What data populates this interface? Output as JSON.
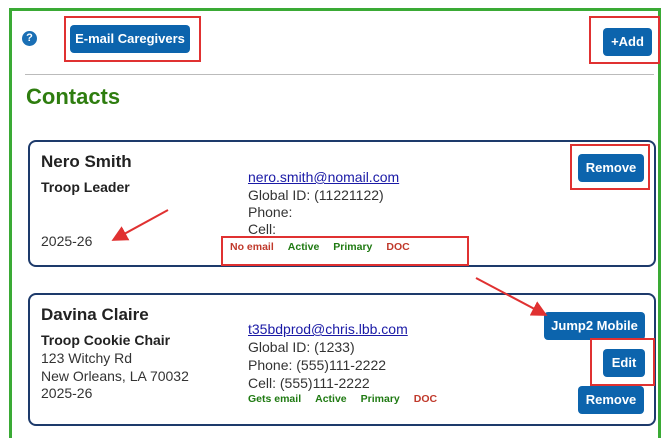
{
  "toolbar": {
    "help_label": "?",
    "email_label": "E-mail Caregivers",
    "add_label": "+Add"
  },
  "title": "Contacts",
  "contacts": [
    {
      "name": "Nero  Smith",
      "role": "Troop Leader",
      "address1": "",
      "address2": "",
      "year": "2025-26",
      "email": "nero.smith@nomail.com",
      "global_id": "Global ID: (11221122)",
      "phone": "Phone:",
      "cell": "Cell:",
      "badges": {
        "email_status": "No email",
        "active": "Active",
        "primary": "Primary",
        "doc": "DOC"
      },
      "buttons": {
        "remove": "Remove"
      }
    },
    {
      "name": "Davina  Claire",
      "role": "Troop Cookie Chair",
      "address1": "123 Witchy Rd",
      "address2": "New Orleans, LA 70032",
      "year": "2025-26",
      "email": "t35bdprod@chris.lbb.com",
      "global_id": "Global ID: (1233)",
      "phone": "Phone: (555)111-2222",
      "cell": "Cell: (555)111-2222",
      "badges": {
        "email_status": "Gets email",
        "active": "Active",
        "primary": "Primary",
        "doc": "DOC"
      },
      "buttons": {
        "jump": "Jump2 Mobile",
        "edit": "Edit",
        "remove": "Remove"
      }
    }
  ],
  "colors": {
    "panel_border": "#3aaa35",
    "button": "#0c64ad",
    "title": "#2e7d0f",
    "annotation": "#e03131",
    "card_border": "#1d3a6b"
  }
}
